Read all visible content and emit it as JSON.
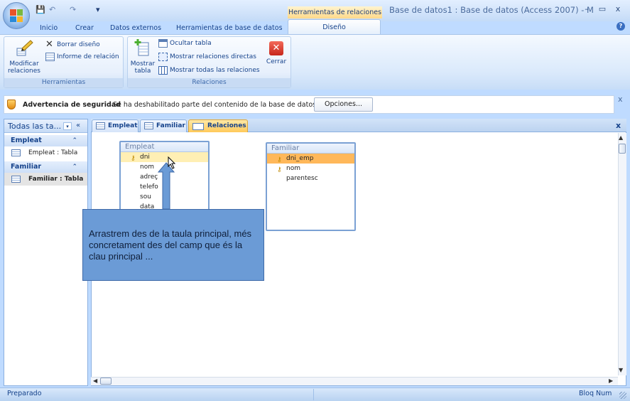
{
  "window": {
    "title": "Base de datos1 : Base de datos (Access 2007) - M",
    "context_tab_header": "Herramientas de relaciones",
    "min": "–",
    "max": "▭",
    "close": "x"
  },
  "quick_access": {
    "save": "💾",
    "undo": "↶",
    "redo": "↷",
    "customize": "▾"
  },
  "ribbon_tabs": [
    "Inicio",
    "Crear",
    "Datos externos",
    "Herramientas de base de datos",
    "Diseño"
  ],
  "help": "?",
  "ribbon": {
    "herramientas": {
      "label": "Herramientas",
      "modificar_line1": "Modificar",
      "modificar_line2": "relaciones",
      "borrar": "Borrar diseño",
      "informe": "Informe de relación"
    },
    "relaciones": {
      "label": "Relaciones",
      "mostrar_tabla_line1": "Mostrar",
      "mostrar_tabla_line2": "tabla",
      "ocultar": "Ocultar tabla",
      "directas": "Mostrar relaciones directas",
      "todas": "Mostrar todas las relaciones",
      "cerrar": "Cerrar"
    }
  },
  "security": {
    "title": "Advertencia de seguridad",
    "message": "Se ha deshabilitado parte del contenido de la base de datos",
    "options": "Opciones...",
    "close": "x"
  },
  "nav": {
    "title": "Todas las ta...",
    "dropdown": "▾",
    "collapse": "«",
    "groups": [
      {
        "name": "Empleat",
        "item": "Empleat : Tabla"
      },
      {
        "name": "Familiar",
        "item": "Familiar : Tabla"
      }
    ],
    "chevron": "⌃"
  },
  "doc_tabs": [
    "Empleat",
    "Familiar",
    "Relaciones"
  ],
  "doc_close": "x",
  "tables": {
    "empleat": {
      "title": "Empleat",
      "fields": [
        "dni",
        "nom",
        "adreç",
        "telefo",
        "sou",
        "data"
      ]
    },
    "familiar": {
      "title": "Familiar",
      "fields": [
        "dni_emp",
        "nom",
        "parentesc"
      ]
    }
  },
  "callout": "Arrastrem des de la taula principal, més concretament des del camp que és la clau principal ...",
  "status": {
    "left": "Preparado",
    "right": "Bloq Num"
  },
  "colors": {
    "ribbon_text": "#15428b",
    "context_tab": "#ffd98a",
    "callout_bg": "#6b9bd6",
    "selected_field": "#ffb85a"
  }
}
